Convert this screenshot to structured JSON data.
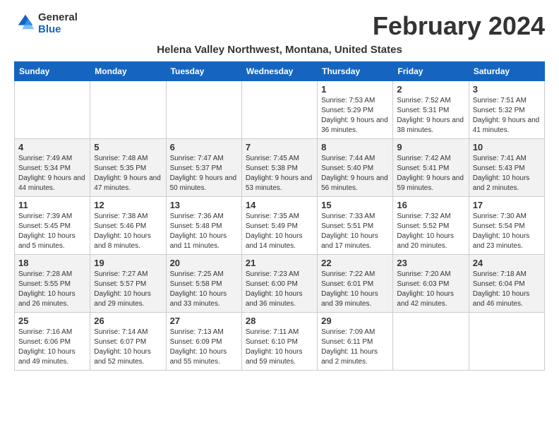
{
  "header": {
    "logo_general": "General",
    "logo_blue": "Blue",
    "month_title": "February 2024",
    "location": "Helena Valley Northwest, Montana, United States"
  },
  "weekdays": [
    "Sunday",
    "Monday",
    "Tuesday",
    "Wednesday",
    "Thursday",
    "Friday",
    "Saturday"
  ],
  "weeks": [
    [
      {
        "day": "",
        "info": ""
      },
      {
        "day": "",
        "info": ""
      },
      {
        "day": "",
        "info": ""
      },
      {
        "day": "",
        "info": ""
      },
      {
        "day": "1",
        "info": "Sunrise: 7:53 AM\nSunset: 5:29 PM\nDaylight: 9 hours and 36 minutes."
      },
      {
        "day": "2",
        "info": "Sunrise: 7:52 AM\nSunset: 5:31 PM\nDaylight: 9 hours and 38 minutes."
      },
      {
        "day": "3",
        "info": "Sunrise: 7:51 AM\nSunset: 5:32 PM\nDaylight: 9 hours and 41 minutes."
      }
    ],
    [
      {
        "day": "4",
        "info": "Sunrise: 7:49 AM\nSunset: 5:34 PM\nDaylight: 9 hours and 44 minutes."
      },
      {
        "day": "5",
        "info": "Sunrise: 7:48 AM\nSunset: 5:35 PM\nDaylight: 9 hours and 47 minutes."
      },
      {
        "day": "6",
        "info": "Sunrise: 7:47 AM\nSunset: 5:37 PM\nDaylight: 9 hours and 50 minutes."
      },
      {
        "day": "7",
        "info": "Sunrise: 7:45 AM\nSunset: 5:38 PM\nDaylight: 9 hours and 53 minutes."
      },
      {
        "day": "8",
        "info": "Sunrise: 7:44 AM\nSunset: 5:40 PM\nDaylight: 9 hours and 56 minutes."
      },
      {
        "day": "9",
        "info": "Sunrise: 7:42 AM\nSunset: 5:41 PM\nDaylight: 9 hours and 59 minutes."
      },
      {
        "day": "10",
        "info": "Sunrise: 7:41 AM\nSunset: 5:43 PM\nDaylight: 10 hours and 2 minutes."
      }
    ],
    [
      {
        "day": "11",
        "info": "Sunrise: 7:39 AM\nSunset: 5:45 PM\nDaylight: 10 hours and 5 minutes."
      },
      {
        "day": "12",
        "info": "Sunrise: 7:38 AM\nSunset: 5:46 PM\nDaylight: 10 hours and 8 minutes."
      },
      {
        "day": "13",
        "info": "Sunrise: 7:36 AM\nSunset: 5:48 PM\nDaylight: 10 hours and 11 minutes."
      },
      {
        "day": "14",
        "info": "Sunrise: 7:35 AM\nSunset: 5:49 PM\nDaylight: 10 hours and 14 minutes."
      },
      {
        "day": "15",
        "info": "Sunrise: 7:33 AM\nSunset: 5:51 PM\nDaylight: 10 hours and 17 minutes."
      },
      {
        "day": "16",
        "info": "Sunrise: 7:32 AM\nSunset: 5:52 PM\nDaylight: 10 hours and 20 minutes."
      },
      {
        "day": "17",
        "info": "Sunrise: 7:30 AM\nSunset: 5:54 PM\nDaylight: 10 hours and 23 minutes."
      }
    ],
    [
      {
        "day": "18",
        "info": "Sunrise: 7:28 AM\nSunset: 5:55 PM\nDaylight: 10 hours and 26 minutes."
      },
      {
        "day": "19",
        "info": "Sunrise: 7:27 AM\nSunset: 5:57 PM\nDaylight: 10 hours and 29 minutes."
      },
      {
        "day": "20",
        "info": "Sunrise: 7:25 AM\nSunset: 5:58 PM\nDaylight: 10 hours and 33 minutes."
      },
      {
        "day": "21",
        "info": "Sunrise: 7:23 AM\nSunset: 6:00 PM\nDaylight: 10 hours and 36 minutes."
      },
      {
        "day": "22",
        "info": "Sunrise: 7:22 AM\nSunset: 6:01 PM\nDaylight: 10 hours and 39 minutes."
      },
      {
        "day": "23",
        "info": "Sunrise: 7:20 AM\nSunset: 6:03 PM\nDaylight: 10 hours and 42 minutes."
      },
      {
        "day": "24",
        "info": "Sunrise: 7:18 AM\nSunset: 6:04 PM\nDaylight: 10 hours and 46 minutes."
      }
    ],
    [
      {
        "day": "25",
        "info": "Sunrise: 7:16 AM\nSunset: 6:06 PM\nDaylight: 10 hours and 49 minutes."
      },
      {
        "day": "26",
        "info": "Sunrise: 7:14 AM\nSunset: 6:07 PM\nDaylight: 10 hours and 52 minutes."
      },
      {
        "day": "27",
        "info": "Sunrise: 7:13 AM\nSunset: 6:09 PM\nDaylight: 10 hours and 55 minutes."
      },
      {
        "day": "28",
        "info": "Sunrise: 7:11 AM\nSunset: 6:10 PM\nDaylight: 10 hours and 59 minutes."
      },
      {
        "day": "29",
        "info": "Sunrise: 7:09 AM\nSunset: 6:11 PM\nDaylight: 11 hours and 2 minutes."
      },
      {
        "day": "",
        "info": ""
      },
      {
        "day": "",
        "info": ""
      }
    ]
  ]
}
